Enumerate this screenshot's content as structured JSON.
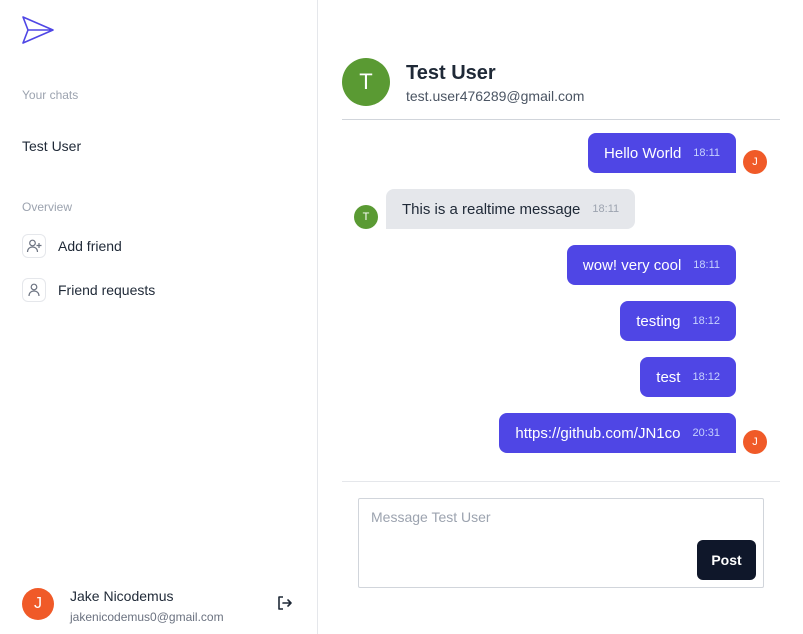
{
  "sidebar": {
    "logo_icon": "paper-plane-icon",
    "your_chats_label": "Your chats",
    "chats": [
      {
        "name": "Test User"
      }
    ],
    "overview_label": "Overview",
    "nav": [
      {
        "label": "Add friend",
        "icon": "add-user-icon"
      },
      {
        "label": "Friend requests",
        "icon": "user-icon"
      }
    ],
    "profile": {
      "initial": "J",
      "name": "Jake Nicodemus",
      "email": "jakenicodemus0@gmail.com",
      "logout_icon": "logout-icon"
    }
  },
  "chat": {
    "partner": {
      "initial": "T",
      "name": "Test User",
      "email": "test.user476289@gmail.com"
    },
    "messages": [
      {
        "text": "Hello World",
        "time": "18:11",
        "sender": "me",
        "avatar": "J"
      },
      {
        "text": "This is a realtime message",
        "time": "18:11",
        "sender": "them",
        "avatar": "T"
      },
      {
        "text": "wow! very cool",
        "time": "18:11",
        "sender": "me",
        "avatar": ""
      },
      {
        "text": "testing",
        "time": "18:12",
        "sender": "me",
        "avatar": ""
      },
      {
        "text": "test",
        "time": "18:12",
        "sender": "me",
        "avatar": ""
      },
      {
        "text": "https://github.com/JN1co",
        "time": "20:31",
        "sender": "me",
        "avatar": "J"
      }
    ]
  },
  "composer": {
    "placeholder": "Message Test User",
    "value": "",
    "post_label": "Post"
  },
  "colors": {
    "accent": "#4f46e5",
    "sent_bubble": "#4f46e5",
    "received_bubble": "#e5e7eb",
    "user_avatar": "#f05a28",
    "partner_avatar": "#5a9a33",
    "post_button": "#0f172a"
  }
}
